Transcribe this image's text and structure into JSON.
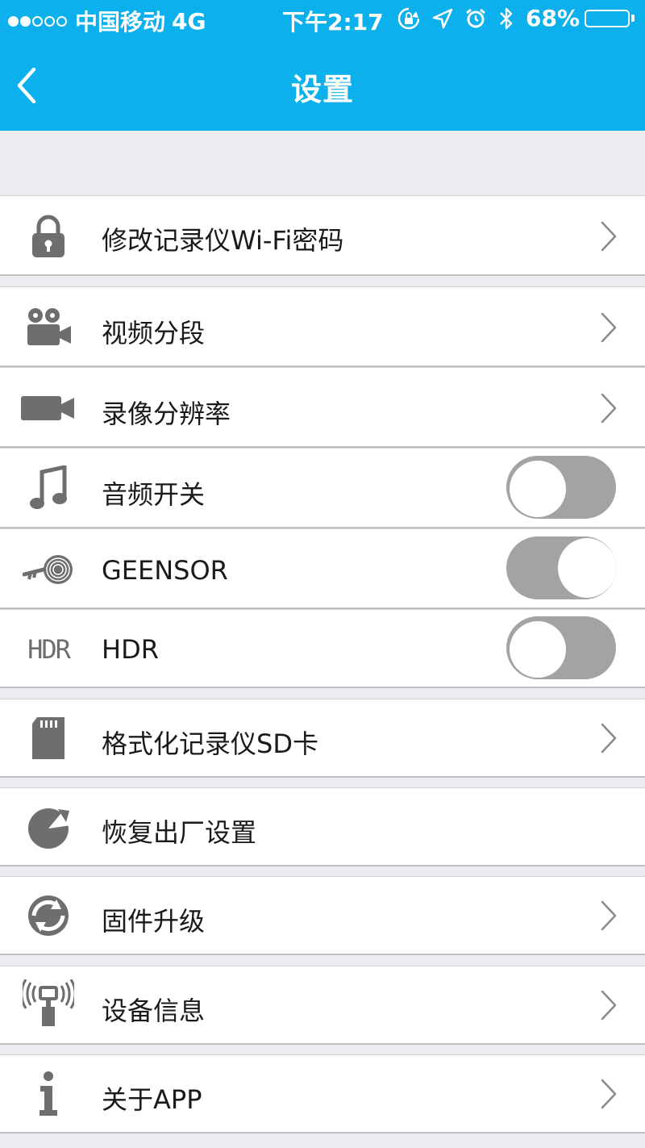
{
  "status_bar": {
    "carrier": "中国移动",
    "network": "4G",
    "time": "下午2:17",
    "battery": "68%",
    "battery_level": 0.68,
    "signal_bars_filled": 2,
    "signal_bars_total": 5,
    "icons": [
      "rotation-lock-icon",
      "location-arrow-icon",
      "alarm-icon",
      "bluetooth-icon"
    ]
  },
  "header": {
    "title": "设置",
    "back_icon": "chevron-left-icon"
  },
  "settings": {
    "items": [
      {
        "label": "修改记录仪Wi-Fi密码",
        "icon": "lock-icon",
        "control": "chevron"
      },
      {
        "label": "视频分段",
        "icon": "video-camera-icon",
        "control": "chevron"
      },
      {
        "label": "录像分辨率",
        "icon": "camcorder-icon",
        "control": "chevron"
      },
      {
        "label": "音频开关",
        "icon": "music-note-icon",
        "control": "toggle",
        "value": false
      },
      {
        "label": "GEENSOR",
        "icon": "g-sensor-icon",
        "control": "toggle",
        "value": true
      },
      {
        "label": "HDR",
        "icon": "hdr-icon",
        "icon_text": "HDR",
        "control": "toggle",
        "value": false
      },
      {
        "label": "格式化记录仪SD卡",
        "icon": "sd-card-icon",
        "control": "chevron"
      },
      {
        "label": "恢复出厂设置",
        "icon": "restore-icon",
        "control": "none"
      },
      {
        "label": "固件升级",
        "icon": "firmware-upgrade-icon",
        "control": "chevron"
      },
      {
        "label": "设备信息",
        "icon": "device-signal-icon",
        "control": "chevron"
      },
      {
        "label": "关于APP",
        "icon": "info-icon",
        "control": "chevron"
      }
    ]
  },
  "colors": {
    "header_bg": "#0bb0ec",
    "page_bg": "#ecebf0",
    "icon_gray": "#6e6e6e",
    "toggle_gray": "#a3a3a3"
  }
}
